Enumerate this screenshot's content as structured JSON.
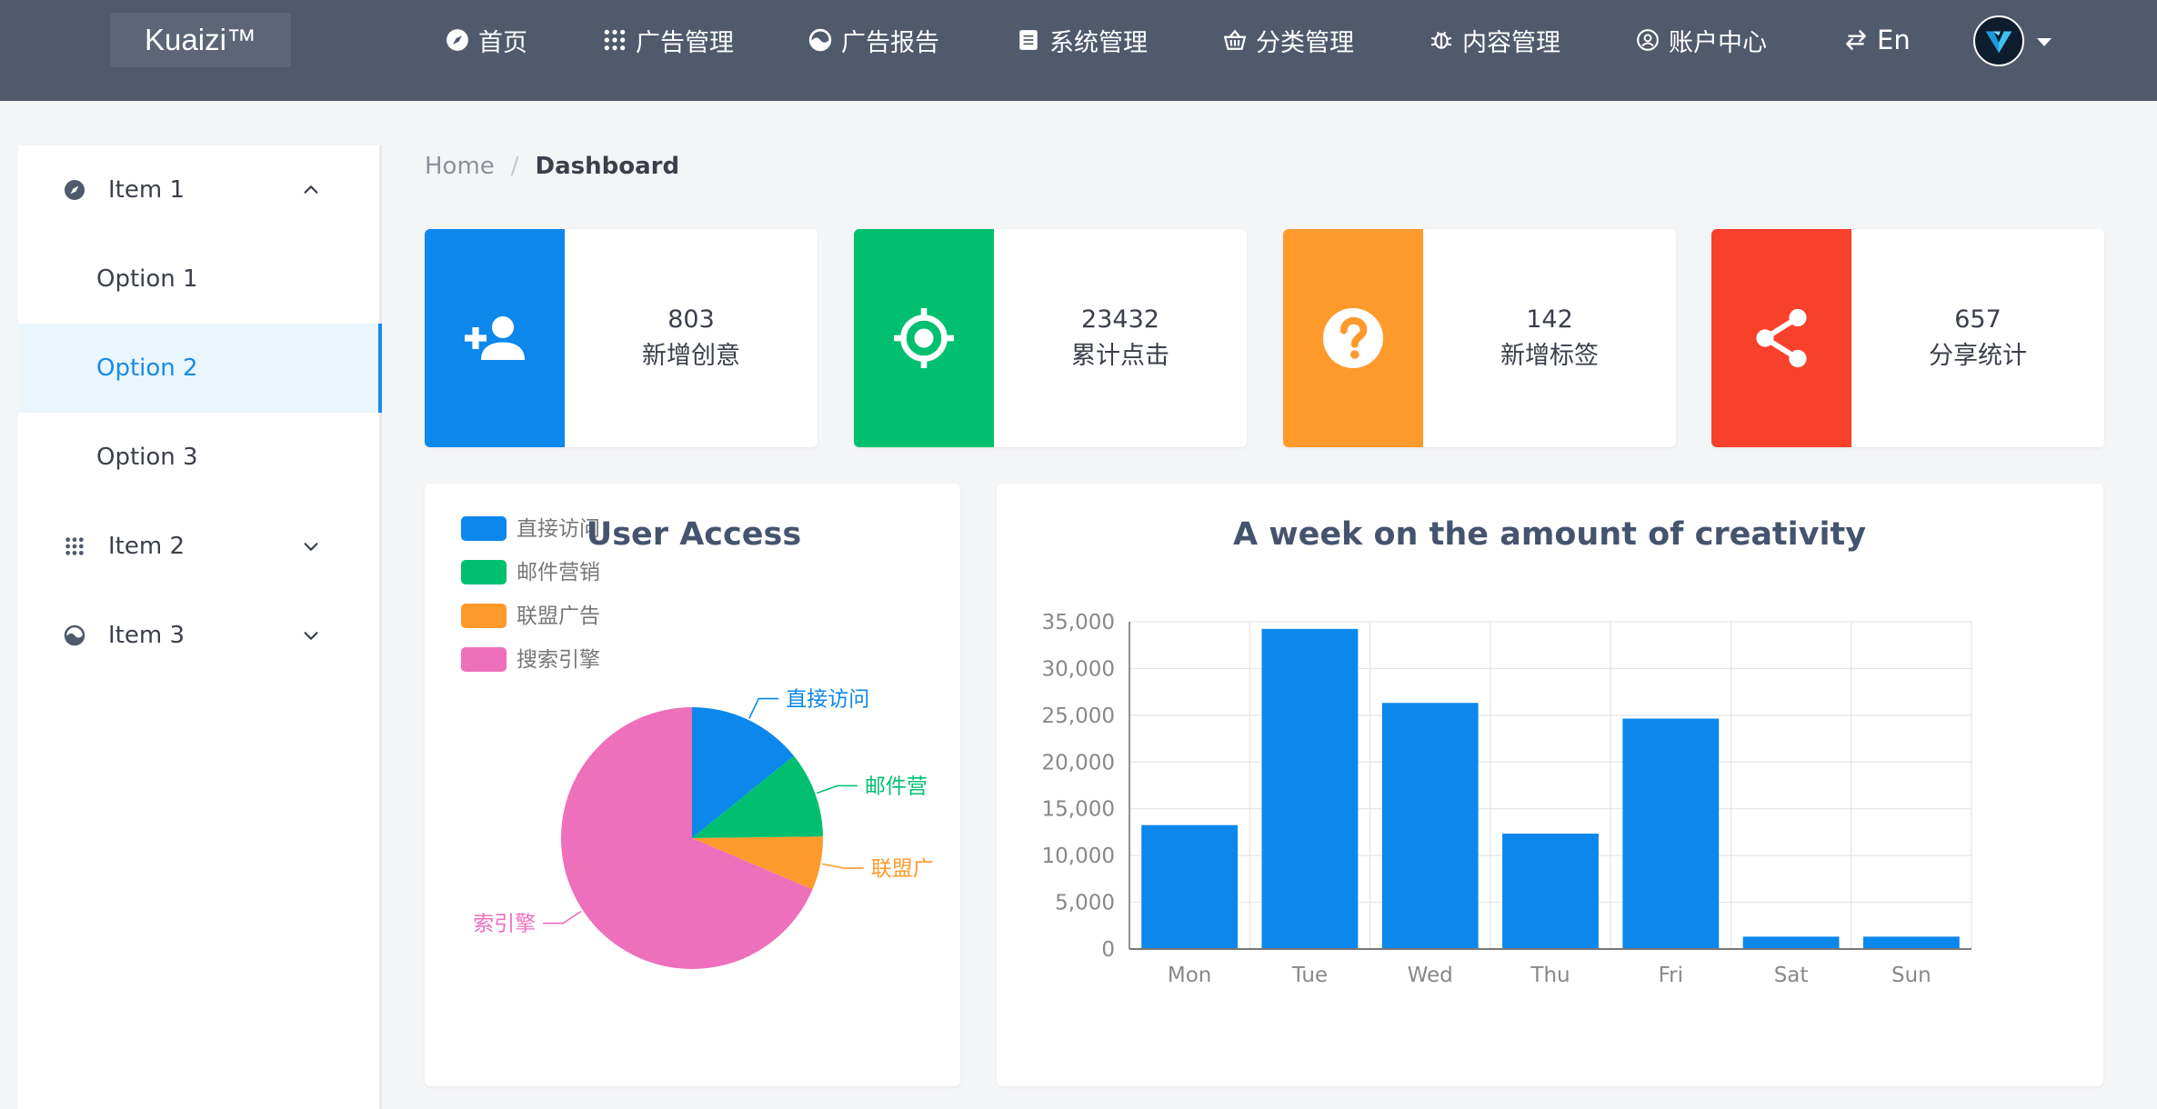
{
  "header": {
    "logo": "Kuaizi™",
    "nav": [
      {
        "label": "首页",
        "icon": "compass-icon"
      },
      {
        "label": "广告管理",
        "icon": "apps-grid-icon"
      },
      {
        "label": "广告报告",
        "icon": "pie-icon"
      },
      {
        "label": "系统管理",
        "icon": "book-icon"
      },
      {
        "label": "分类管理",
        "icon": "basket-icon"
      },
      {
        "label": "内容管理",
        "icon": "bug-icon"
      },
      {
        "label": "账户中心",
        "icon": "account-icon"
      },
      {
        "label": "En",
        "icon": "swap-icon"
      }
    ]
  },
  "sidebar": {
    "items": [
      {
        "label": "Item 1",
        "icon": "compass-icon",
        "expanded": true,
        "options": [
          "Option 1",
          "Option 2",
          "Option 3"
        ],
        "active_option": "Option 2"
      },
      {
        "label": "Item 2",
        "icon": "apps-grid-icon",
        "expanded": false
      },
      {
        "label": "Item 3",
        "icon": "pie-icon",
        "expanded": false
      }
    ]
  },
  "breadcrumb": {
    "home": "Home",
    "separator": "/",
    "current": "Dashboard"
  },
  "stats": [
    {
      "value": "803",
      "label": "新增创意",
      "color": "#0c87ec",
      "icon": "add-user-icon"
    },
    {
      "value": "23432",
      "label": "累计点击",
      "color": "#00c06f",
      "icon": "target-icon"
    },
    {
      "value": "142",
      "label": "新增标签",
      "color": "#fe9a2c",
      "icon": "help-circle-icon"
    },
    {
      "value": "657",
      "label": "分享统计",
      "color": "#f7412b",
      "icon": "share-icon"
    }
  ],
  "chart_data": [
    {
      "type": "pie",
      "title": "User Access",
      "legend_position": "top-left",
      "categories": [
        "直接访问",
        "邮件营销",
        "联盟广告",
        "搜索引擎"
      ],
      "outer_labels": [
        "直接访问",
        "邮件营",
        "联盟广",
        "索引擎"
      ],
      "values": [
        320,
        240,
        149,
        1548
      ],
      "colors": [
        "#0c87ec",
        "#00c06f",
        "#fe9a2c",
        "#ee6fbc"
      ]
    },
    {
      "type": "bar",
      "title": "A week on the amount of creativity",
      "categories": [
        "Mon",
        "Tue",
        "Wed",
        "Thu",
        "Fri",
        "Sat",
        "Sun"
      ],
      "values": [
        13253,
        34235,
        26321,
        12340,
        24643,
        1322,
        1324
      ],
      "ylim": [
        0,
        35000
      ],
      "yticks": [
        "0",
        "5,000",
        "10,000",
        "15,000",
        "20,000",
        "25,000",
        "30,000",
        "35,000"
      ],
      "grid": true,
      "color": "#0c87ec"
    }
  ]
}
